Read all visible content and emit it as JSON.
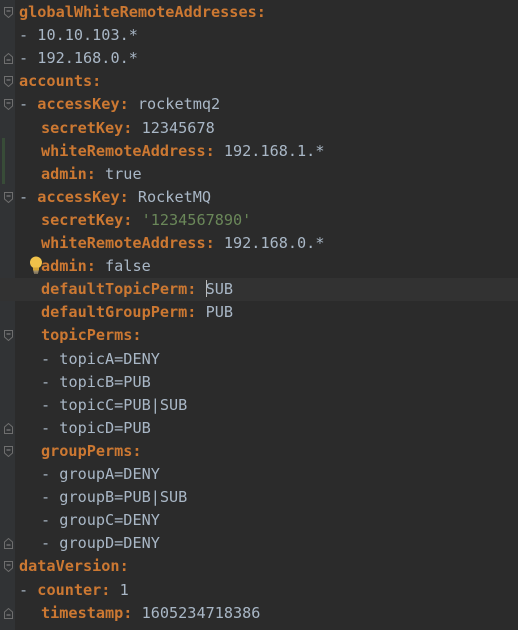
{
  "file": {
    "lines": [
      {
        "parts": [
          {
            "t": "key",
            "v": "globalWhiteRemoteAddresses:"
          }
        ]
      },
      {
        "parts": [
          {
            "t": "dash",
            "v": "- "
          },
          {
            "t": "val",
            "v": "10.10.103.*"
          }
        ]
      },
      {
        "parts": [
          {
            "t": "dash",
            "v": "- "
          },
          {
            "t": "val",
            "v": "192.168.0.*"
          }
        ]
      },
      {
        "parts": [
          {
            "t": "key",
            "v": "accounts:"
          }
        ]
      },
      {
        "parts": [
          {
            "t": "dash",
            "v": "- "
          },
          {
            "t": "key",
            "v": "accessKey:"
          },
          {
            "t": "val",
            "v": " rocketmq2"
          }
        ]
      },
      {
        "parts": [
          {
            "t": "key",
            "v": "secretKey:"
          },
          {
            "t": "val",
            "v": " 12345678"
          }
        ]
      },
      {
        "parts": [
          {
            "t": "key",
            "v": "whiteRemoteAddress:"
          },
          {
            "t": "val",
            "v": " 192.168.1.*"
          }
        ]
      },
      {
        "parts": [
          {
            "t": "key",
            "v": "admin:"
          },
          {
            "t": "val",
            "v": " true"
          }
        ]
      },
      {
        "parts": [
          {
            "t": "dash",
            "v": "- "
          },
          {
            "t": "key",
            "v": "accessKey:"
          },
          {
            "t": "val",
            "v": " RocketMQ"
          }
        ]
      },
      {
        "parts": [
          {
            "t": "key",
            "v": "secretKey:"
          },
          {
            "t": "val",
            "v": " "
          },
          {
            "t": "str",
            "v": "'1234567890'"
          }
        ]
      },
      {
        "parts": [
          {
            "t": "key",
            "v": "whiteRemoteAddress:"
          },
          {
            "t": "val",
            "v": " 192.168.0.*"
          }
        ]
      },
      {
        "parts": [
          {
            "t": "key",
            "v": "admin:"
          },
          {
            "t": "val",
            "v": " false"
          }
        ]
      },
      {
        "parts": [
          {
            "t": "key",
            "v": "defaultTopicPerm:"
          },
          {
            "t": "val",
            "v": " "
          },
          {
            "t": "caret",
            "v": ""
          },
          {
            "t": "val",
            "v": "SUB"
          }
        ]
      },
      {
        "parts": [
          {
            "t": "key",
            "v": "defaultGroupPerm:"
          },
          {
            "t": "val",
            "v": " PUB"
          }
        ]
      },
      {
        "parts": [
          {
            "t": "key",
            "v": "topicPerms:"
          }
        ]
      },
      {
        "parts": [
          {
            "t": "dash",
            "v": "- "
          },
          {
            "t": "val",
            "v": "topicA=DENY"
          }
        ]
      },
      {
        "parts": [
          {
            "t": "dash",
            "v": "- "
          },
          {
            "t": "val",
            "v": "topicB=PUB"
          }
        ]
      },
      {
        "parts": [
          {
            "t": "dash",
            "v": "- "
          },
          {
            "t": "val",
            "v": "topicC=PUB|SUB"
          }
        ]
      },
      {
        "parts": [
          {
            "t": "dash",
            "v": "- "
          },
          {
            "t": "val",
            "v": "topicD=PUB"
          }
        ]
      },
      {
        "parts": [
          {
            "t": "key",
            "v": "groupPerms:"
          }
        ]
      },
      {
        "parts": [
          {
            "t": "dash",
            "v": "- "
          },
          {
            "t": "val",
            "v": "groupA=DENY"
          }
        ]
      },
      {
        "parts": [
          {
            "t": "dash",
            "v": "- "
          },
          {
            "t": "val",
            "v": "groupB=PUB|SUB"
          }
        ]
      },
      {
        "parts": [
          {
            "t": "dash",
            "v": "- "
          },
          {
            "t": "val",
            "v": "groupC=DENY"
          }
        ]
      },
      {
        "parts": [
          {
            "t": "dash",
            "v": "- "
          },
          {
            "t": "val",
            "v": "groupD=DENY"
          }
        ]
      },
      {
        "parts": [
          {
            "t": "key",
            "v": "dataVersion:"
          }
        ]
      },
      {
        "parts": [
          {
            "t": "dash",
            "v": "- "
          },
          {
            "t": "key",
            "v": "counter:"
          },
          {
            "t": "val",
            "v": " 1"
          }
        ]
      },
      {
        "parts": [
          {
            "t": "key",
            "v": "timestamp:"
          },
          {
            "t": "val",
            "v": " 1605234718386"
          }
        ]
      }
    ]
  },
  "colors": {
    "background": "#2b2b2b",
    "key": "#cc7832",
    "text": "#a9b7c6",
    "string": "#6a8759",
    "gutter": "#313335",
    "current_line": "#323232"
  },
  "icons": {
    "fold_open": "fold-open-icon",
    "fold_close": "fold-close-icon",
    "intention": "lightbulb-icon"
  }
}
